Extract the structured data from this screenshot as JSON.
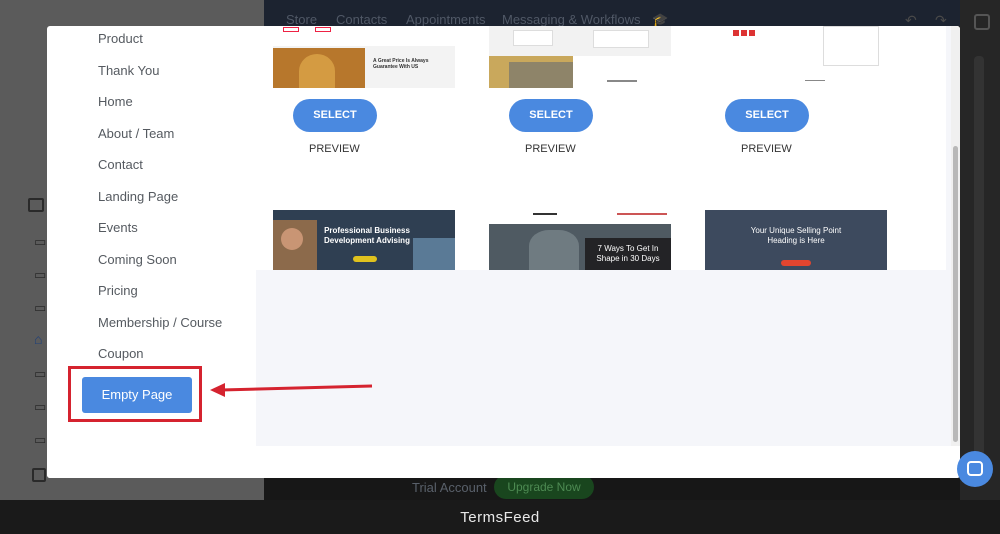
{
  "background_app": {
    "nav_tabs": [
      "Store",
      "Contacts",
      "Appointments",
      "Messaging & Workflows"
    ],
    "footer": {
      "trial_label": "Trial Account",
      "upgrade_label": "Upgrade Now"
    }
  },
  "modal": {
    "categories": [
      "Product",
      "Thank You",
      "Home",
      "About / Team",
      "Contact",
      "Landing Page",
      "Events",
      "Coming Soon",
      "Pricing",
      "Membership / Course",
      "Coupon"
    ],
    "empty_page_label": "Empty Page",
    "templates_row1": [
      {
        "select_label": "SELECT",
        "preview_label": "PREVIEW",
        "thumb_caption": "A Great Price Is Always Guarantee With US"
      },
      {
        "select_label": "SELECT",
        "preview_label": "PREVIEW",
        "thumb_caption": ""
      },
      {
        "select_label": "SELECT",
        "preview_label": "PREVIEW",
        "thumb_caption": ""
      }
    ],
    "templates_row2": [
      {
        "thumb_caption": "Professional Business Development Advising"
      },
      {
        "thumb_caption": "7 Ways To Get In Shape in 30 Days"
      },
      {
        "thumb_caption": "Your Unique Selling Point Heading is Here"
      }
    ]
  },
  "caption": "TermsFeed",
  "colors": {
    "primary_blue": "#4a89e0",
    "highlight_red": "#d5232f",
    "upgrade_green": "#19461e"
  }
}
